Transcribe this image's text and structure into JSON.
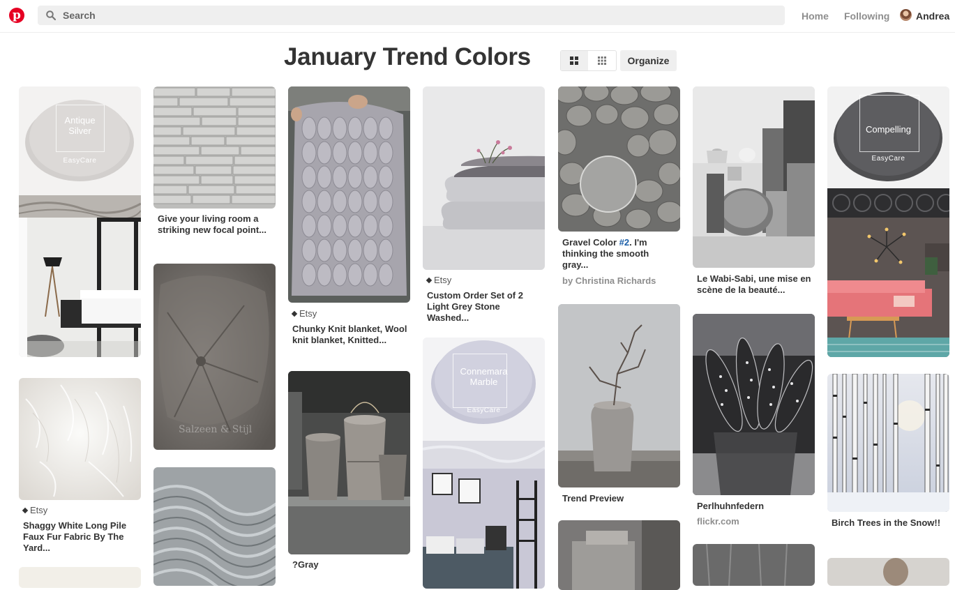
{
  "header": {
    "logo_letter": "p",
    "search_placeholder": "Search",
    "nav_home": "Home",
    "nav_following": "Following",
    "user_name": "Andrea"
  },
  "board": {
    "title": "January Trend Colors",
    "organize_label": "Organize"
  },
  "pins": {
    "antique": {
      "chip_line1": "Antique",
      "chip_line2": "Silver",
      "chip_brand": "EasyCare"
    },
    "stone_wall": {
      "title": "Give your living room a striking new focal point..."
    },
    "knit": {
      "source": "Etsy",
      "title": "Chunky Knit blanket, Wool knit blanket, Knitted..."
    },
    "pillows": {
      "source": "Etsy",
      "title": "Custom Order Set of 2 Light Grey Stone Washed..."
    },
    "gravel": {
      "title_prefix": "Gravel Color ",
      "title_highlight": "#2",
      "title_suffix": ". I'm thinking the smooth gray...",
      "byline": "by Christina Richards"
    },
    "wabi": {
      "title": "Le Wabi-Sabi, une mise en scène de la beauté..."
    },
    "compelling": {
      "chip_line1": "Compelling",
      "chip_brand": "EasyCare"
    },
    "fur": {
      "source": "Etsy",
      "title": "Shaggy White Long Pile Faux Fur Fabric By The Yard..."
    },
    "velvet": {
      "watermark": "Salzeen & Stijl"
    },
    "gray_pots": {
      "title": "?Gray"
    },
    "connemara": {
      "chip_line1": "Connemara",
      "chip_line2": "Marble",
      "chip_brand": "EasyCare"
    },
    "vase": {
      "title": "Trend Preview"
    },
    "feathers": {
      "title": "Perlhuhnfedern",
      "sub": "flickr.com"
    },
    "birch": {
      "title": "Birch Trees in the Snow!!"
    }
  },
  "colors": {
    "brand_red": "#e60023",
    "link_blue": "#1a5ea8"
  },
  "icons": [
    "pinterest-logo-icon",
    "search-icon",
    "avatar",
    "grid-large-icon",
    "grid-small-icon",
    "tag-icon"
  ]
}
